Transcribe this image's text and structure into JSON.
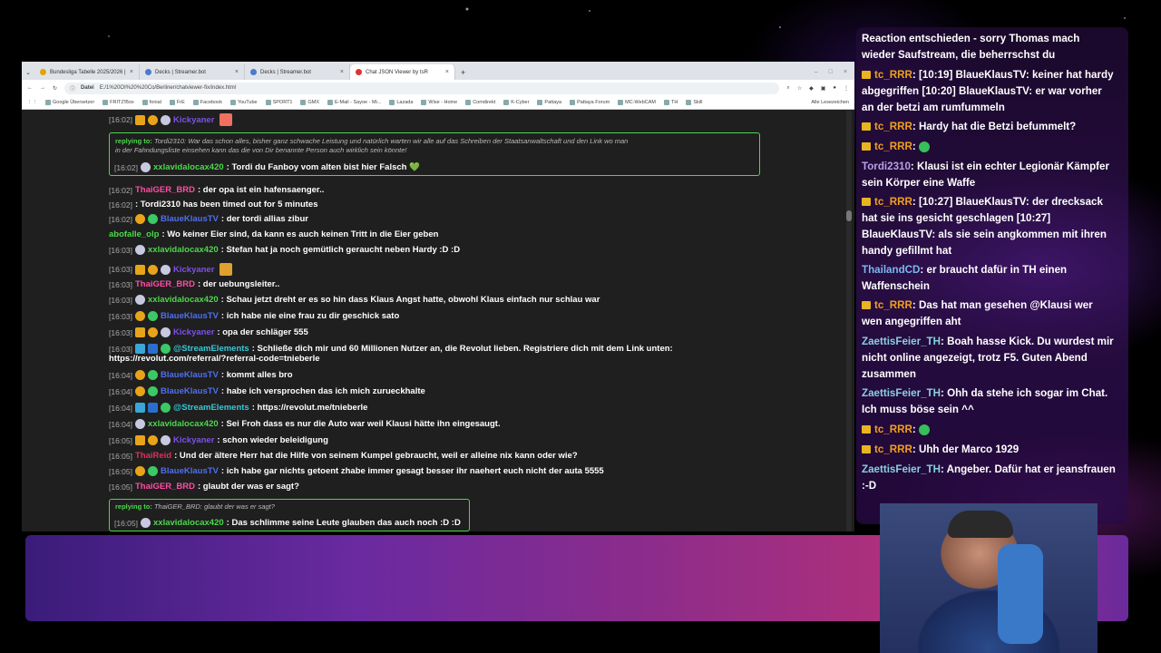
{
  "browser": {
    "tabs": [
      {
        "label": "Bundesliga Tabelle 2025/2026 |",
        "icon": "doc-icon"
      },
      {
        "label": "Decks | Streamer.bot",
        "icon": "streamerbot-icon"
      },
      {
        "label": "Decks | Streamer.bot",
        "icon": "streamerbot-icon"
      },
      {
        "label": "Chat JSON Viewer by tsR",
        "icon": "chat-icon"
      }
    ],
    "address_label": "Datei",
    "address": "E:/1%20OI%20%20Co/Berliner/chatviewer-fix/index.html",
    "bookmarks": [
      "Google Übersetzer",
      "FRITZ!Box",
      "fonial",
      "FrE",
      "Facebook",
      "YouTube",
      "SPORT1",
      "GMX",
      "E-Mail - Sayoe - Mi...",
      "Lazada",
      "Wise - Home",
      "Comdirekt",
      "K-Cyber",
      "Pattaya",
      "Pattaya Forum",
      "MC-WebCAM",
      "TH",
      "Skill",
      "Alle Lesezeichen"
    ]
  },
  "chat": {
    "rows": [
      {
        "ts": "[16:02]",
        "badges": [
          "b-crown",
          "b-sub",
          "b-flag"
        ],
        "user": "Kickyaner",
        "color": "#7b52e8",
        "msg": ""
      },
      {
        "ts": "[16:02]",
        "badges": [
          "b-flag"
        ],
        "user": "xxlavidalocax420",
        "color": "#4cd84c",
        "msg": ": Tordi du Fanboy vom alten bist hier Falsch 💚"
      },
      {
        "ts": "[16:02]",
        "badges": [],
        "user": "ThaiGER_BRD",
        "color": "#ff4da6",
        "msg": ": der opa ist ein hafensaenger.."
      },
      {
        "ts": "[16:02]",
        "badges": [],
        "user": "",
        "color": "#fff",
        "msg": ": Tordi2310 has been timed out for 5 minutes"
      },
      {
        "ts": "[16:02]",
        "badges": [
          "b-sub",
          "b-ver"
        ],
        "user": "BlaueKlausTV",
        "color": "#4f6ff0",
        "msg": ": der tordi allias zibur"
      },
      {
        "ts": "",
        "badges": [],
        "user": "abofalle_olp",
        "color": "#4cd84c",
        "msg": ": Wo keiner Eier sind, da kann es auch keinen Tritt in die Eier geben"
      },
      {
        "ts": "[16:03]",
        "badges": [
          "b-flag"
        ],
        "user": "xxlavidalocax420",
        "color": "#4cd84c",
        "msg": ": Stefan hat ja noch gemütlich geraucht neben Hardy :D :D"
      },
      {
        "ts": "[16:03]",
        "badges": [
          "b-crown",
          "b-sub",
          "b-flag"
        ],
        "user": "Kickyaner",
        "color": "#7b52e8",
        "msg": ""
      },
      {
        "ts": "[16:03]",
        "badges": [],
        "user": "ThaiGER_BRD",
        "color": "#ff4da6",
        "msg": ": der uebungsleiter.."
      },
      {
        "ts": "[16:03]",
        "badges": [
          "b-flag"
        ],
        "user": "xxlavidalocax420",
        "color": "#4cd84c",
        "msg": ": Schau jetzt dreht er es so hin dass Klaus Angst hatte, obwohl Klaus einfach nur schlau war"
      },
      {
        "ts": "[16:03]",
        "badges": [
          "b-sub",
          "b-ver"
        ],
        "user": "BlaueKlausTV",
        "color": "#4f6ff0",
        "msg": ": ich habe nie eine frau zu dir geschick sato"
      },
      {
        "ts": "[16:03]",
        "badges": [
          "b-crown",
          "b-sub",
          "b-flag"
        ],
        "user": "Kickyaner",
        "color": "#7b52e8",
        "msg": ": opa der schläger 555"
      },
      {
        "ts": "[16:03]",
        "badges": [
          "b-bot",
          "b-blue",
          "b-ver"
        ],
        "user": "@StreamElements",
        "color": "#38c8d8",
        "msg": ": Schließe dich mir und 60 Millionen Nutzer an, die Revolut lieben. Registriere dich mit dem Link unten:"
      },
      {
        "ts": "",
        "badges": [],
        "user": "",
        "color": "#fff",
        "msg": "https://revolut.com/referral/?referral-code=tnieberle"
      },
      {
        "ts": "[16:04]",
        "badges": [
          "b-sub",
          "b-ver"
        ],
        "user": "BlaueKlausTV",
        "color": "#4f6ff0",
        "msg": ": kommt alles bro"
      },
      {
        "ts": "[16:04]",
        "badges": [
          "b-sub",
          "b-ver"
        ],
        "user": "BlaueKlausTV",
        "color": "#4f6ff0",
        "msg": ": habe ich versprochen das ich mich zurueckhalte"
      },
      {
        "ts": "[16:04]",
        "badges": [
          "b-bot",
          "b-blue",
          "b-ver"
        ],
        "user": "@StreamElements",
        "color": "#38c8d8",
        "msg": ": https://revolut.me/tnieberle"
      },
      {
        "ts": "[16:04]",
        "badges": [
          "b-flag"
        ],
        "user": "xxlavidalocax420",
        "color": "#4cd84c",
        "msg": ": Sei Froh dass es nur die Auto war weil Klausi hätte ihn eingesaugt."
      },
      {
        "ts": "[16:05]",
        "badges": [
          "b-crown",
          "b-sub",
          "b-flag"
        ],
        "user": "Kickyaner",
        "color": "#7b52e8",
        "msg": ": schon wieder beleidigung"
      },
      {
        "ts": "[16:05]",
        "badges": [],
        "user": "ThaiReid",
        "color": "#e0305a",
        "msg": ": Und der ältere Herr hat die Hilfe von seinem Kumpel gebraucht, weil er alleine nix kann oder wie?"
      },
      {
        "ts": "[16:05]",
        "badges": [
          "b-sub",
          "b-ver"
        ],
        "user": "BlaueKlausTV",
        "color": "#4f6ff0",
        "msg": ": ich habe gar nichts getoent zhabe immer gesagt besser ihr naehert euch nicht der auta 5555"
      },
      {
        "ts": "[16:05]",
        "badges": [],
        "user": "ThaiGER_BRD",
        "color": "#ff4da6",
        "msg": ": glaubt der was er sagt?"
      },
      {
        "ts": "[16:05]",
        "badges": [
          "b-flag"
        ],
        "user": "xxlavidalocax420",
        "color": "#4cd84c",
        "msg": ": Das schlimme seine Leute glauben das auch noch :D :D"
      }
    ],
    "reply1_label": "replying to:",
    "reply1_text": "Tordi2310: War das schon alles, bisher ganz schwache Leistung und natürlich warten wir alle auf das Schreiben der Staatsanwaltschaft und den Link wo man",
    "reply1_text2": "in der Fahndungsliste einsehen kann das die von Dir benannte Person auch wirklich sein könnte!",
    "reply2_label": "replying to:",
    "reply2_text": "ThaiGER_BRD: glaubt der was er sagt?"
  },
  "side_chat": [
    {
      "crown": false,
      "user": "",
      "color": "#fff",
      "text": "Reaction entschieden - sorry Thomas mach wieder Saufstream, die beherrschst du"
    },
    {
      "crown": true,
      "user": "tc_RRR",
      "color": "#f0a020",
      "text": ": [10:19] BlaueKlausTV: keiner hat hardy abgegriffen [10:20] BlaueKlausTV: er war vorher an der betzi am rumfummeln"
    },
    {
      "crown": true,
      "user": "tc_RRR",
      "color": "#f0a020",
      "text": ": Hardy hat die Betzi befummelt?"
    },
    {
      "crown": true,
      "user": "tc_RRR",
      "color": "#f0a020",
      "text": ":",
      "emote": true
    },
    {
      "crown": false,
      "user": "Tordi2310",
      "color": "#b8a0e8",
      "text": ": Klausi ist ein echter Legionär Kämpfer sein Körper eine Waffe"
    },
    {
      "crown": true,
      "user": "tc_RRR",
      "color": "#f0a020",
      "text": ": [10:27] BlaueKlausTV: der drecksack hat sie ins gesicht geschlagen [10:27] BlaueKlausTV: als sie sein angkommen mit ihren handy gefillmt hat"
    },
    {
      "crown": false,
      "user": "ThailandCD",
      "color": "#7ab8f0",
      "text": ": er braucht dafür in TH einen Waffenschein"
    },
    {
      "crown": true,
      "user": "tc_RRR",
      "color": "#f0a020",
      "text": ": Das hat man gesehen @Klausi wer wen angegriffen aht"
    },
    {
      "crown": false,
      "user": "ZaettisFeier_TH",
      "color": "#8ad0e0",
      "text": ": Boah hasse Kick. Du wurdest mir nicht online angezeigt, trotz F5. Guten Abend zusammen"
    },
    {
      "crown": false,
      "user": "ZaettisFeier_TH",
      "color": "#8ad0e0",
      "text": ": Ohh da stehe ich sogar im Chat. Ich muss böse sein ^^"
    },
    {
      "crown": true,
      "user": "tc_RRR",
      "color": "#f0a020",
      "text": ":",
      "emote": true
    },
    {
      "crown": true,
      "user": "tc_RRR",
      "color": "#f0a020",
      "text": ": Uhh der Marco 1929"
    },
    {
      "crown": false,
      "user": "ZaettisFeier_TH",
      "color": "#8ad0e0",
      "text": ": Angeber. Dafür hat er jeansfrauen :-D"
    }
  ]
}
